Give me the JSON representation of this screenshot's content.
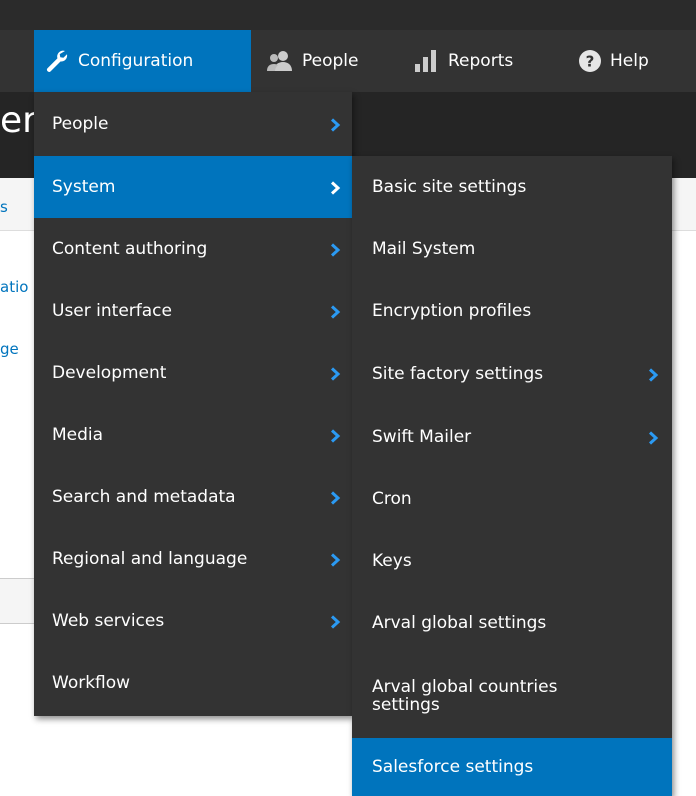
{
  "toolbar": {
    "items": [
      {
        "label": "Configuration",
        "icon": "wrench-icon"
      },
      {
        "label": "People",
        "icon": "people-icon"
      },
      {
        "label": "Reports",
        "icon": "bar-chart-icon"
      },
      {
        "label": "Help",
        "icon": "help-icon"
      }
    ]
  },
  "background": {
    "title_fragment": "er",
    "links": [
      "s",
      "atio",
      "ge"
    ]
  },
  "menu": {
    "items": [
      {
        "label": "People",
        "has_submenu": true
      },
      {
        "label": "System",
        "has_submenu": true,
        "active": true
      },
      {
        "label": "Content authoring",
        "has_submenu": true
      },
      {
        "label": "User interface",
        "has_submenu": true
      },
      {
        "label": "Development",
        "has_submenu": true
      },
      {
        "label": "Media",
        "has_submenu": true
      },
      {
        "label": "Search and metadata",
        "has_submenu": true
      },
      {
        "label": "Regional and language",
        "has_submenu": true
      },
      {
        "label": "Web services",
        "has_submenu": true
      },
      {
        "label": "Workflow",
        "has_submenu": false
      }
    ]
  },
  "submenu": {
    "items": [
      {
        "label": "Basic site settings",
        "has_submenu": false
      },
      {
        "label": "Mail System",
        "has_submenu": false
      },
      {
        "label": "Encryption profiles",
        "has_submenu": false
      },
      {
        "label": "Site factory settings",
        "has_submenu": true
      },
      {
        "label": "Swift Mailer",
        "has_submenu": true
      },
      {
        "label": "Cron",
        "has_submenu": false
      },
      {
        "label": "Keys",
        "has_submenu": false
      },
      {
        "label": "Arval global settings",
        "has_submenu": false
      },
      {
        "label": "Arval global countries settings",
        "has_submenu": false
      },
      {
        "label": "Salesforce settings",
        "has_submenu": false,
        "active": true
      }
    ]
  },
  "colors": {
    "accent": "#0074bd",
    "toolbar_bg": "#333333",
    "menu_bg": "#333333",
    "menu_text": "#ffffff",
    "chevron": "#2b9af3"
  }
}
